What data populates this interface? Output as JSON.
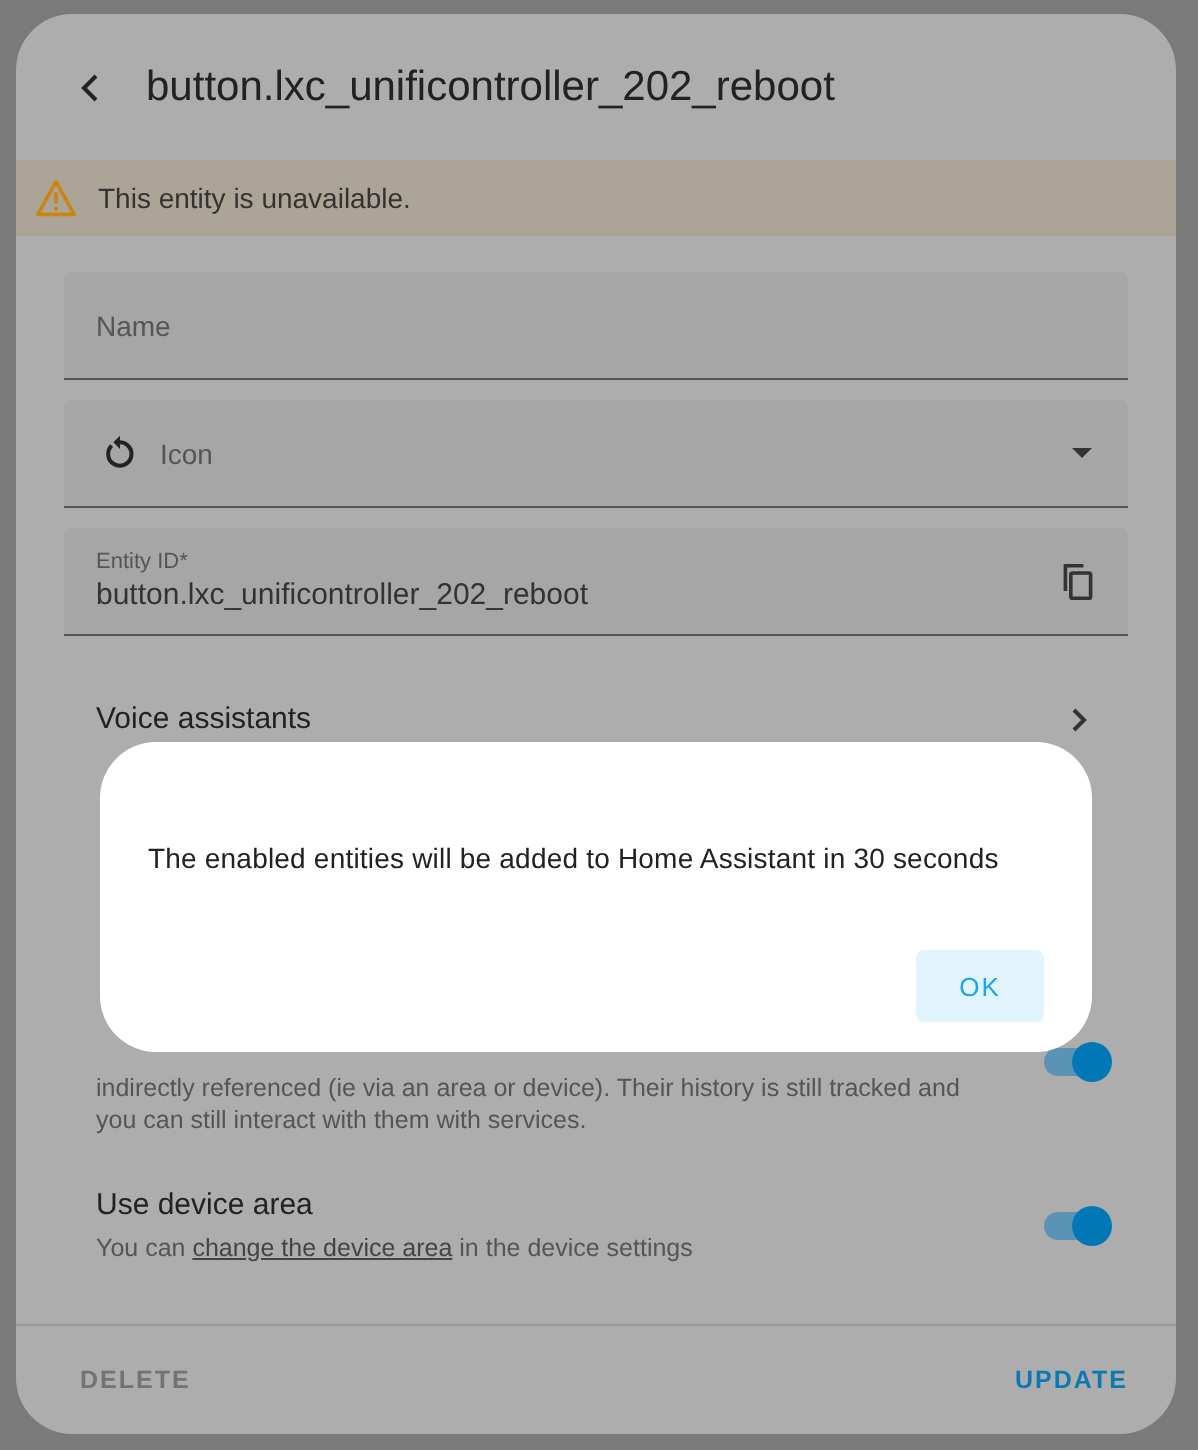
{
  "dialog": {
    "title": "button.lxc_unificontroller_202_reboot",
    "warning": "This entity is unavailable.",
    "fields": [
      {
        "kind": "text",
        "placeholder": "Name"
      },
      {
        "kind": "select",
        "placeholder": "Icon"
      },
      {
        "kind": "copy",
        "label": "Entity ID*",
        "value": "button.lxc_unificontroller_202_reboot"
      }
    ],
    "voice_assistants": {
      "title": "Voice assistants"
    },
    "visible_row": {
      "description": "indirectly referenced (ie via an area or device). Their history is still tracked and you can still interact with them with services.",
      "on": true
    },
    "device_area": {
      "title": "Use device area",
      "text_before": "You can",
      "link": "change the device area",
      "text_after": "in the device settings",
      "on": true
    },
    "buttons": [
      {
        "label": "DELETE",
        "disabled": true
      },
      {
        "label": "UPDATE",
        "disabled": false
      }
    ]
  },
  "alert": {
    "message": "The enabled entities will be added to Home Assistant in 30 seconds",
    "button": "OK"
  }
}
